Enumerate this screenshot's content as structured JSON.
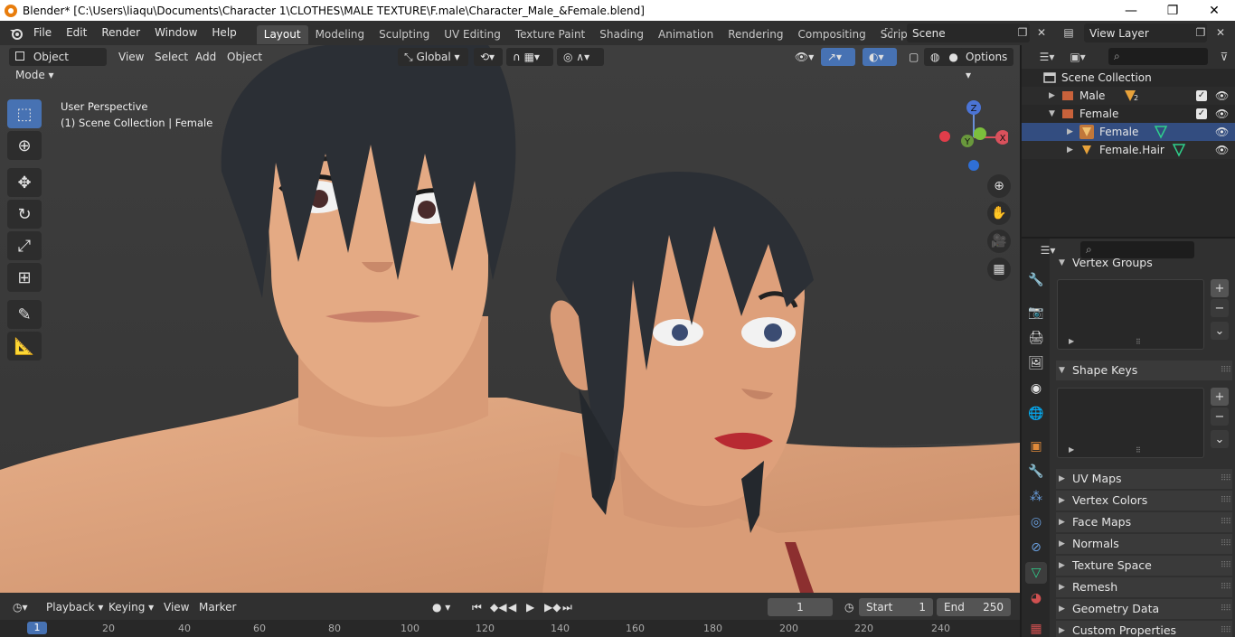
{
  "window": {
    "title": "Blender* [C:\\Users\\liaqu\\Documents\\Character 1\\CLOTHES\\MALE TEXTURE\\F.male\\Character_Male_&Female.blend]",
    "minimize": "—",
    "maximize": "❐",
    "close": "✕"
  },
  "menu": [
    "File",
    "Edit",
    "Render",
    "Window",
    "Help"
  ],
  "workspaces": [
    "Layout",
    "Modeling",
    "Sculpting",
    "UV Editing",
    "Texture Paint",
    "Shading",
    "Animation",
    "Rendering",
    "Compositing",
    "Scripting"
  ],
  "active_workspace": "Layout",
  "scene_name": "Scene",
  "view_layer": "View Layer",
  "viewport": {
    "mode": "Object Mode",
    "menus": [
      "View",
      "Select",
      "Add",
      "Object"
    ],
    "transform_orientation": "Global",
    "options_label": "Options",
    "info_line1": "User Perspective",
    "info_line2": "(1) Scene Collection | Female",
    "gizmo_axes": {
      "x": "X",
      "y": "Y",
      "z": "Z"
    }
  },
  "timeline": {
    "menus": [
      "Playback",
      "Keying",
      "View",
      "Marker"
    ],
    "current_frame": "1",
    "start_label": "Start",
    "start_value": "1",
    "end_label": "End",
    "end_value": "250",
    "ruler": [
      "1",
      "20",
      "40",
      "60",
      "80",
      "100",
      "120",
      "140",
      "160",
      "180",
      "200",
      "220",
      "240"
    ]
  },
  "outliner": {
    "root": "Scene Collection",
    "items": [
      {
        "label": "Male",
        "badge": "2"
      },
      {
        "label": "Female"
      },
      {
        "label": "Female"
      },
      {
        "label": "Female.Hair"
      }
    ]
  },
  "properties": {
    "vertex_groups": "Vertex Groups",
    "shape_keys": "Shape Keys",
    "collapsed_panels": [
      "UV Maps",
      "Vertex Colors",
      "Face Maps",
      "Normals",
      "Texture Space",
      "Remesh",
      "Geometry Data",
      "Custom Properties"
    ]
  },
  "colors": {
    "accent": "#4772b3",
    "viewport_bg": "#3d3d3d",
    "panel_bg": "#303030",
    "skin": "#e0a57f",
    "hair": "#2b2f35"
  }
}
